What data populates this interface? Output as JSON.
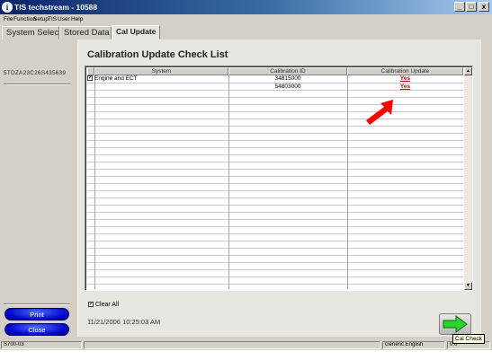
{
  "window": {
    "title": "TIS techstream - 10588",
    "minimize_glyph": "_",
    "maximize_glyph": "□",
    "close_glyph": "x",
    "app_icon_glyph": "i"
  },
  "menu": [
    "File",
    "Function",
    "Setup",
    "TIS",
    "User",
    "Help"
  ],
  "tabs": [
    {
      "label": "System Select",
      "active": false
    },
    {
      "label": "Stored Data",
      "active": false
    },
    {
      "label": "Cal Update",
      "active": true
    }
  ],
  "sidebar": {
    "vin": "5TDZA23C26S435639",
    "print_label": "Print",
    "close_label": "Close"
  },
  "panel": {
    "title": "Calibration Update Check List",
    "columns": [
      "System",
      "Calibration ID",
      "Calibration Update"
    ],
    "rows": [
      {
        "checked": true,
        "check_glyph": "✓",
        "system": "Engine and ECT",
        "calibration_id": "34815000",
        "update": "Yes"
      },
      {
        "checked": false,
        "check_glyph": "",
        "system": "",
        "calibration_id": "54803000",
        "update": "Yes"
      }
    ],
    "clear_all_label": "Clear All",
    "clear_all_checked": true,
    "clear_all_glyph": "✓",
    "datetime": "11/21/2006 10:25:03 AM",
    "scroll_up_glyph": "▲",
    "scroll_down_glyph": "▼"
  },
  "annotation": {
    "arrow_color": "#ff0000",
    "arrow_points_to": "calibration-update-yes-link"
  },
  "cal_check": {
    "tooltip": "Cal Check",
    "arrow_color": "#2bd42b"
  },
  "statusbar": {
    "left": "S700-03",
    "language": "Generic English",
    "right": "0.0"
  },
  "colors": {
    "title_blue": "#0a246a",
    "button_blue": "#0000c8",
    "link_red": "#c00000"
  }
}
